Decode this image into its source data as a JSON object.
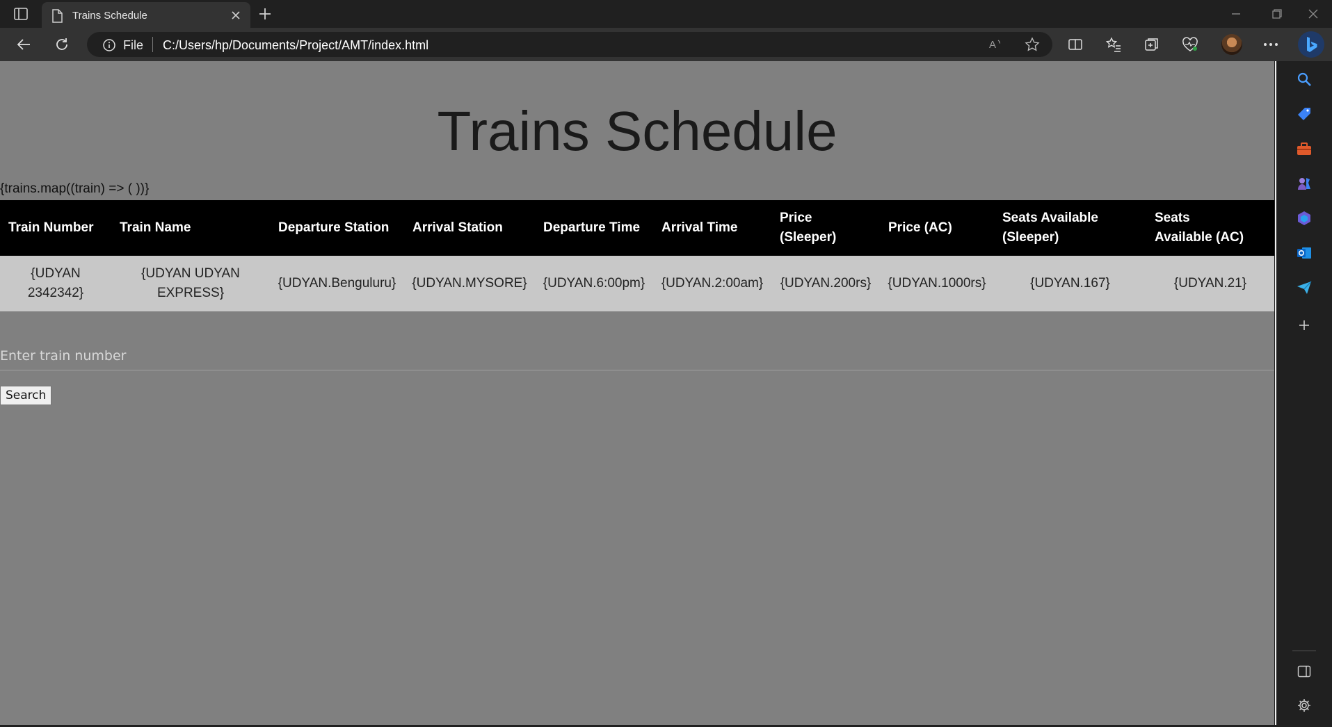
{
  "browser": {
    "tab_title": "Trains Schedule",
    "address_scheme": "File",
    "address_url": "C:/Users/hp/Documents/Project/AMT/index.html"
  },
  "page": {
    "title": "Trains Schedule",
    "jsx_text": "{trains.map((train) => ( ))}",
    "table": {
      "headers": [
        "Train Number",
        "Train Name",
        "Departure Station",
        "Arrival Station",
        "Departure Time",
        "Arrival Time",
        "Price (Sleeper)",
        "Price (AC)",
        "Seats Available (Sleeper)",
        "Seats Available (AC)"
      ],
      "rows": [
        [
          "{UDYAN 2342342}",
          "{UDYAN UDYAN EXPRESS}",
          "{UDYAN.Benguluru}",
          "{UDYAN.MYSORE}",
          "{UDYAN.6:00pm}",
          "{UDYAN.2:00am}",
          "{UDYAN.200rs}",
          "{UDYAN.1000rs}",
          "{UDYAN.167}",
          "{UDYAN.21}"
        ]
      ]
    },
    "search": {
      "placeholder": "Enter train number",
      "button_label": "Search"
    }
  }
}
